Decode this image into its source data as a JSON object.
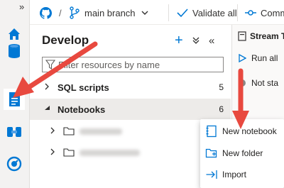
{
  "rail": {
    "collapse_glyph": "»",
    "items": [
      {
        "name": "home-icon",
        "active": false
      },
      {
        "name": "data-icon",
        "active": false
      },
      {
        "name": "develop-icon",
        "active": true
      },
      {
        "name": "integrate-icon",
        "active": false
      },
      {
        "name": "monitor-icon",
        "active": false
      }
    ]
  },
  "toolbar": {
    "repo_icon": "github-icon",
    "separator": "/",
    "branch_icon": "branch-icon",
    "branch_label": "main branch",
    "validate_label": "Validate all",
    "commit_label": "Comm"
  },
  "panel": {
    "title": "Develop",
    "add_glyph": "+",
    "expand_glyph": "⌄",
    "collapse_glyph": "«",
    "filter_placeholder": "Filter resources by name",
    "tree": [
      {
        "label": "SQL scripts",
        "count": "5",
        "expanded": false
      },
      {
        "label": "Notebooks",
        "count": "6",
        "expanded": true
      }
    ]
  },
  "right_pane": {
    "tab_label": "Stream T",
    "run_label": "Run all",
    "status_label": "Not sta"
  },
  "context_menu": {
    "items": [
      {
        "label": "New notebook",
        "icon": "notebook-icon"
      },
      {
        "label": "New folder",
        "icon": "new-folder-icon"
      },
      {
        "label": "Import",
        "icon": "import-icon"
      }
    ]
  },
  "colors": {
    "accent": "#0078d4",
    "annotation_arrow": "#e8493f",
    "rail_bg": "#f3f2f1",
    "selected_row": "#edebe9"
  }
}
